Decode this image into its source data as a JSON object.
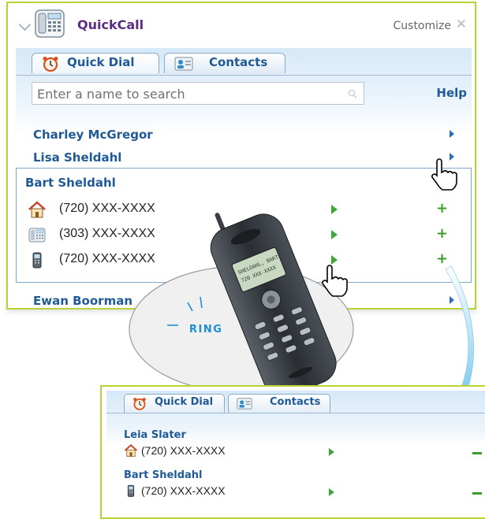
{
  "app": {
    "title": "QuickCall",
    "customize_label": "Customize",
    "close_glyph": "✕",
    "tabs": [
      {
        "label": "Quick Dial",
        "icon": "alarm-clock-icon"
      },
      {
        "label": "Contacts",
        "icon": "address-card-icon"
      }
    ],
    "search": {
      "placeholder": "Enter a name to search"
    },
    "help_label": "Help",
    "contacts": [
      {
        "name": "Charley McGregor"
      },
      {
        "name": "Lisa Sheldahl"
      },
      {
        "name": "Bart Sheldahl"
      },
      {
        "name": "Ewan Boorman"
      }
    ],
    "expanded_contact": {
      "name": "Bart Sheldahl",
      "numbers": [
        {
          "number": "(720) XXX-XXXX",
          "icon": "home-icon"
        },
        {
          "number": "(303) XXX-XXXX",
          "icon": "office-phone-icon"
        },
        {
          "number": "(720) XXX-XXXX",
          "icon": "mobile-phone-icon"
        }
      ]
    }
  },
  "phone_overlay": {
    "ring_label": "RING",
    "screen_line1": "SHELDAHL, BART",
    "screen_line2": "720 XXX-XXXX"
  },
  "quick_dial_panel": {
    "tabs": [
      {
        "label": "Quick Dial",
        "icon": "alarm-clock-icon"
      },
      {
        "label": "Contacts",
        "icon": "address-card-icon"
      }
    ],
    "entries": [
      {
        "name": "Leia Slater",
        "number": "(720) XXX-XXXX",
        "icon": "home-icon"
      },
      {
        "name": "Bart Sheldahl",
        "number": "(720) XXX-XXXX",
        "icon": "mobile-phone-icon"
      }
    ]
  },
  "colors": {
    "accent_green": "#b6d434",
    "title_purple": "#5a2d82",
    "link_blue": "#1f5a97",
    "action_green": "#3fa63b",
    "arrow_blue": "#39a9e0"
  }
}
